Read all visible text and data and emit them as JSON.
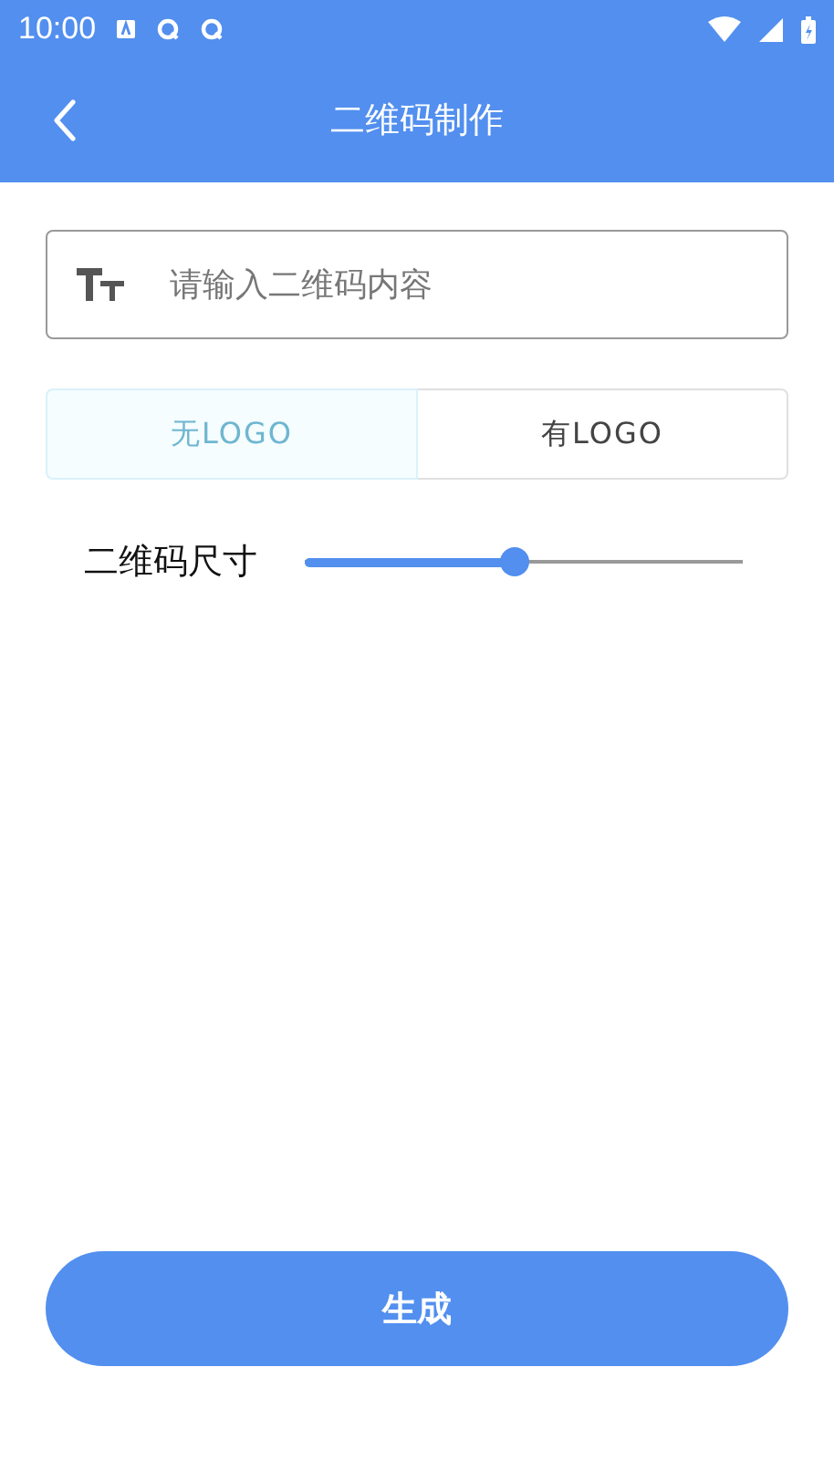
{
  "status_bar": {
    "time": "10:00"
  },
  "app_bar": {
    "title": "二维码制作"
  },
  "content_field": {
    "placeholder": "请输入二维码内容"
  },
  "logo_options": [
    {
      "label": "无LOGO",
      "selected": true
    },
    {
      "label": "有LOGO",
      "selected": false
    }
  ],
  "size_slider": {
    "label": "二维码尺寸",
    "level": 0.48
  },
  "generate_button": {
    "label": "生成"
  }
}
